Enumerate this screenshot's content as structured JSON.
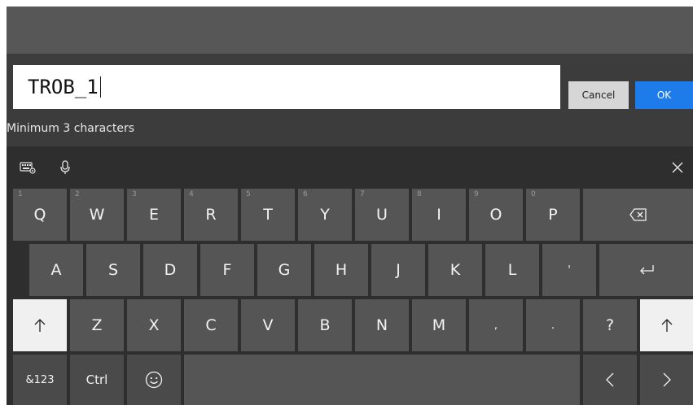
{
  "input": {
    "value": "TROB_1",
    "hint": "Minimum 3 characters"
  },
  "buttons": {
    "cancel_label": "Cancel",
    "ok_label": "OK"
  },
  "colors": {
    "ok_button": "#1e7bea",
    "key_background": "#555555",
    "keyboard_background": "#2e2e2e"
  },
  "keyboard": {
    "toolbar": {
      "icons": [
        "keyboard-settings-icon",
        "microphone-icon",
        "close-icon"
      ]
    },
    "row1": [
      {
        "label": "Q",
        "num": "1"
      },
      {
        "label": "W",
        "num": "2"
      },
      {
        "label": "E",
        "num": "3"
      },
      {
        "label": "R",
        "num": "4"
      },
      {
        "label": "T",
        "num": "5"
      },
      {
        "label": "Y",
        "num": "6"
      },
      {
        "label": "U",
        "num": "7"
      },
      {
        "label": "I",
        "num": "8"
      },
      {
        "label": "O",
        "num": "9"
      },
      {
        "label": "P",
        "num": "0"
      }
    ],
    "row2": [
      "A",
      "S",
      "D",
      "F",
      "G",
      "H",
      "J",
      "K",
      "L",
      "'"
    ],
    "row3": [
      "Z",
      "X",
      "C",
      "V",
      "B",
      "N",
      "M",
      ",",
      ".",
      "?"
    ],
    "symbols_label": "&123",
    "ctrl_label": "Ctrl"
  }
}
